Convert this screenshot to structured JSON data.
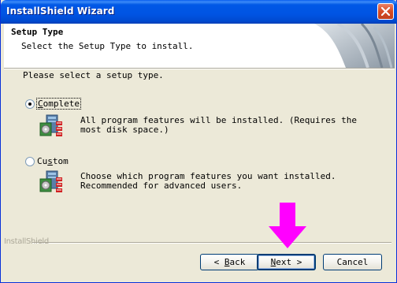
{
  "window": {
    "title": "InstallShield Wizard"
  },
  "header": {
    "title": "Setup Type",
    "subtitle": "Select the Setup Type to install."
  },
  "prompt": "Please select a setup type.",
  "options": [
    {
      "label": "Complete",
      "mnemonic": "C",
      "rest": "omplete",
      "checked": true,
      "description": "All program features will be installed. (Requires the most disk space.)"
    },
    {
      "label": "Custom",
      "mnemonic": "s",
      "pre": "Cu",
      "rest": "tom",
      "checked": false,
      "description": "Choose which program features you want installed. Recommended for advanced users."
    }
  ],
  "branding": "InstallShield",
  "buttons": {
    "back": {
      "prefix": "< ",
      "mnemonic": "B",
      "rest": "ack"
    },
    "next": {
      "mnemonic": "N",
      "rest": "ext",
      "suffix": " >"
    },
    "cancel": {
      "label": "Cancel"
    }
  },
  "annotation": {
    "arrow_color": "#FF00FF"
  },
  "colors": {
    "titlebar": "#0054E3",
    "dialog_bg": "#ECE9D8"
  }
}
